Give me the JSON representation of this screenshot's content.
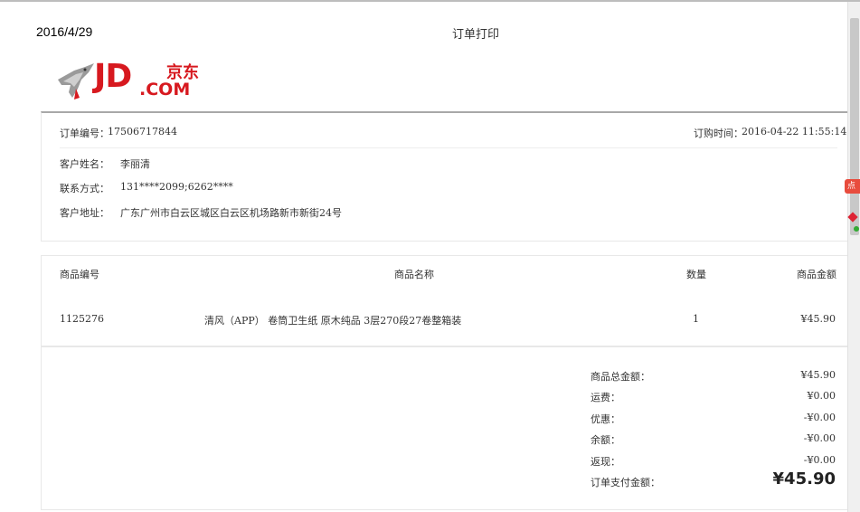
{
  "header": {
    "date": "2016/4/29",
    "title": "订单打印"
  },
  "logo": {
    "brand": "JD",
    "brand_cn": "京东",
    "domain": ".COM"
  },
  "order": {
    "number_label": "订单编号：",
    "number": "17506717844",
    "time_label": "订购时间：",
    "time": "2016-04-22 11:55:14",
    "customer_label": "客户姓名：",
    "customer": "李丽清",
    "contact_label": "联系方式：",
    "contact": "131****2099;6262****",
    "address_label": "客户地址：",
    "address": "广东广州市白云区城区白云区机场路新市新街24号"
  },
  "items_table": {
    "columns": [
      "商品编号",
      "商品名称",
      "数量",
      "商品金额"
    ],
    "rows": [
      {
        "id": "1125276",
        "name": "清风（APP） 卷筒卫生纸 原木纯品 3层270段27卷整箱装",
        "qty": "1",
        "amount": "¥45.90"
      }
    ]
  },
  "summary": {
    "rows": [
      {
        "label": "商品总金额：",
        "value": "¥45.90"
      },
      {
        "label": "运费：",
        "value": "¥0.00"
      },
      {
        "label": "优惠：",
        "value": "-¥0.00"
      },
      {
        "label": "余额：",
        "value": "-¥0.00"
      },
      {
        "label": "返现：",
        "value": "-¥0.00"
      }
    ],
    "total_label": "订单支付金额：",
    "total_value": "¥45.90"
  },
  "side": {
    "badge": "点我"
  },
  "colors": {
    "brand_red": "#d7191f",
    "rule_gray": "#a8a8a8"
  }
}
